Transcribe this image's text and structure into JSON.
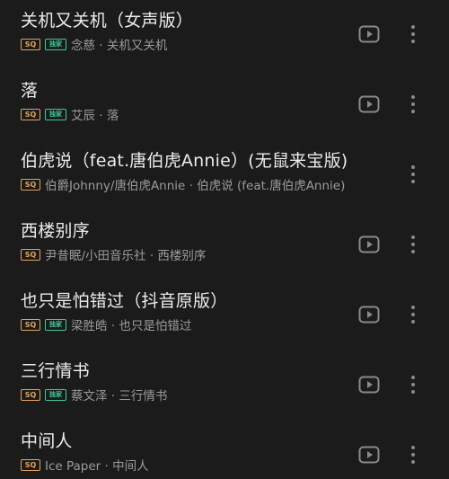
{
  "songs": [
    {
      "title": "关机又关机（女声版）",
      "quality_badge": "SQ",
      "exclusive_badge": "独家",
      "subtitle": "念慈 · 关机又关机"
    },
    {
      "title": "落",
      "quality_badge": "SQ",
      "exclusive_badge": "独家",
      "subtitle": "艾辰 · 落"
    },
    {
      "title": "伯虎说（feat.唐伯虎Annie）(无鼠来宝版)",
      "quality_badge": "SQ",
      "subtitle": "伯爵Johnny/唐伯虎Annie · 伯虎说 (feat.唐伯虎Annie)"
    },
    {
      "title": "西楼别序",
      "quality_badge": "SQ",
      "subtitle": "尹昔眠/小田音乐社 · 西楼别序"
    },
    {
      "title": "也只是怕错过（抖音原版）",
      "quality_badge": "SQ",
      "exclusive_badge": "独家",
      "subtitle": "梁胜皓 · 也只是怕错过"
    },
    {
      "title": "三行情书",
      "quality_badge": "SQ",
      "exclusive_badge": "独家",
      "subtitle": "蔡文泽 · 三行情书"
    },
    {
      "title": "中间人",
      "quality_badge": "SQ",
      "subtitle": "Ice Paper · 中间人"
    }
  ],
  "icons": {
    "play": "play-video-icon",
    "more": "more-vertical-icon"
  },
  "colors": {
    "background": "#1b1b1b",
    "title": "#ececec",
    "subtitle": "#9b9b9b",
    "sq_badge": "#e2a35a",
    "exclusive_badge": "#3fc79d",
    "icon": "#8a8a8a"
  }
}
